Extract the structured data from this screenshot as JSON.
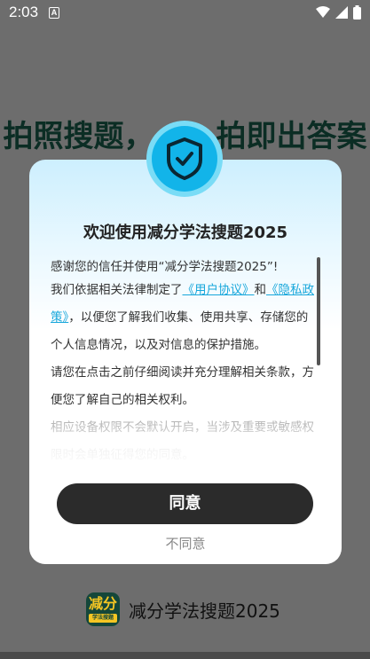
{
  "status_bar": {
    "time": "2:03",
    "notification_glyph": "A",
    "icons": [
      "wifi-icon",
      "signal-icon",
      "battery-icon"
    ]
  },
  "background": {
    "headline_left": "拍照搜题，",
    "headline_right": "拍即出答案",
    "brand_logo_top": "减分",
    "brand_logo_bottom": "学法搜题",
    "brand_name": "减分学法搜题2025"
  },
  "dialog": {
    "icon": "shield-check-icon",
    "title": "欢迎使用减分学法搜题2025",
    "intro": "感谢您的信任并使用“减分学法搜题2025”!",
    "para_prefix": "我们依据相关法律制定了",
    "user_agreement": "《用户协议》",
    "and": "和",
    "privacy_policy": "《隐私政策》",
    "para_suffix": "，以便您了解我们收集、使用共享、存储您的个人信息情况，以及对信息的保护措施。",
    "para2": "请您在点击之前仔细阅读并充分理解相关条款，方便您了解自己的相关权利。",
    "para3": "相应设备权限不会默认开启，当涉及重要或敏感权限时会单独征得您的同意。",
    "agree_label": "同意",
    "disagree_label": "不同意"
  },
  "colors": {
    "overlay": "#6d6d6d",
    "accent": "#12b4e9",
    "link": "#17a7db",
    "button": "#2b2b2b",
    "headline": "#0b2d24"
  }
}
